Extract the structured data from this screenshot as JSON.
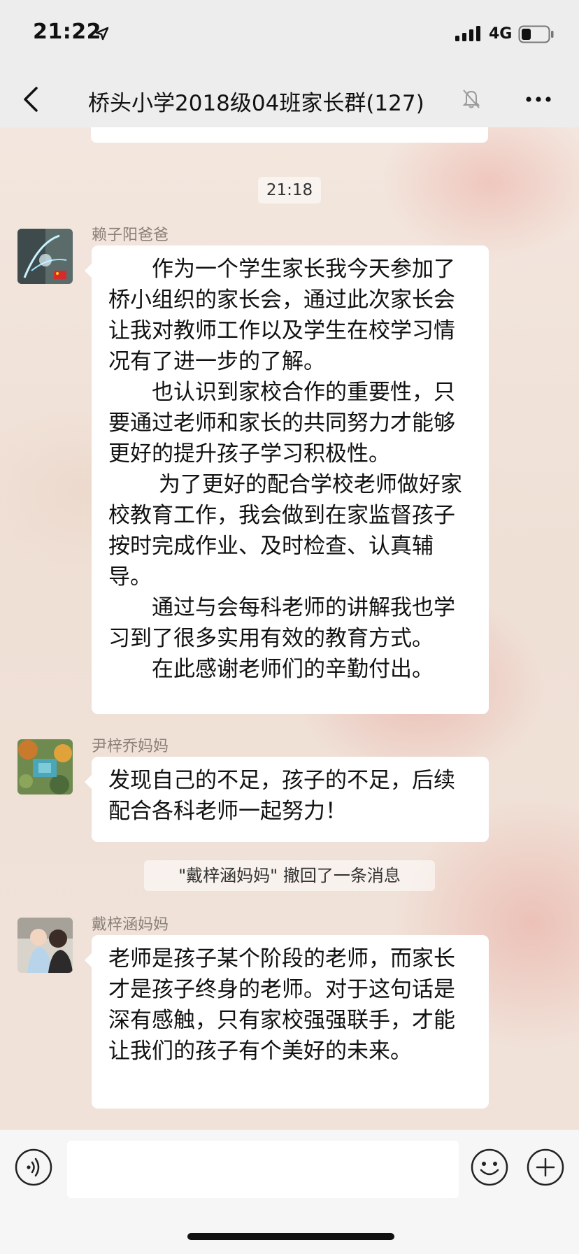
{
  "status_bar": {
    "time": "21:22",
    "network": "4G"
  },
  "nav": {
    "title": "桥头小学2018级04班家长群(127)",
    "icons": [
      "back-icon",
      "mute-bell-icon",
      "more-icon"
    ]
  },
  "messages": {
    "timestamp": "21:18",
    "m1": {
      "sender": "赖子阳爸爸",
      "lines": [
        "　　作为一个学生家长我今天参加了桥小组织的家长会，通过此次家长会让我对教师工作以及学生在校学习情况有了进一步的了解。",
        "　　也认识到家校合作的重要性，只要通过老师和家长的共同努力才能够更好的提升孩子学习积极性。",
        "　　 为了更好的配合学校老师做好家校教育工作，我会做到在家监督孩子按时完成作业、及时检查、认真辅导。",
        "　　通过与会每科老师的讲解我也学习到了很多实用有效的教育方式。",
        "　　在此感谢老师们的辛勤付出。"
      ]
    },
    "m2": {
      "sender": "尹梓乔妈妈",
      "text": "发现自己的不足，孩子的不足，后续配合各科老师一起努力！"
    },
    "recall_notice": "\"戴梓涵妈妈\" 撤回了一条消息",
    "m3": {
      "sender": "戴梓涵妈妈",
      "text": "老师是孩子某个阶段的老师，而家长才是孩子终身的老师。对于这句话是深有感触，只有家校强强联手，才能让我们的孩子有个美好的未来。"
    }
  },
  "input_bar": {
    "message_value": "",
    "icons": [
      "voice-icon",
      "emoji-icon",
      "plus-icon"
    ]
  },
  "colors": {
    "bubble": "#ffffff",
    "bar": "#ededed",
    "sender_name": "#8a8078"
  }
}
